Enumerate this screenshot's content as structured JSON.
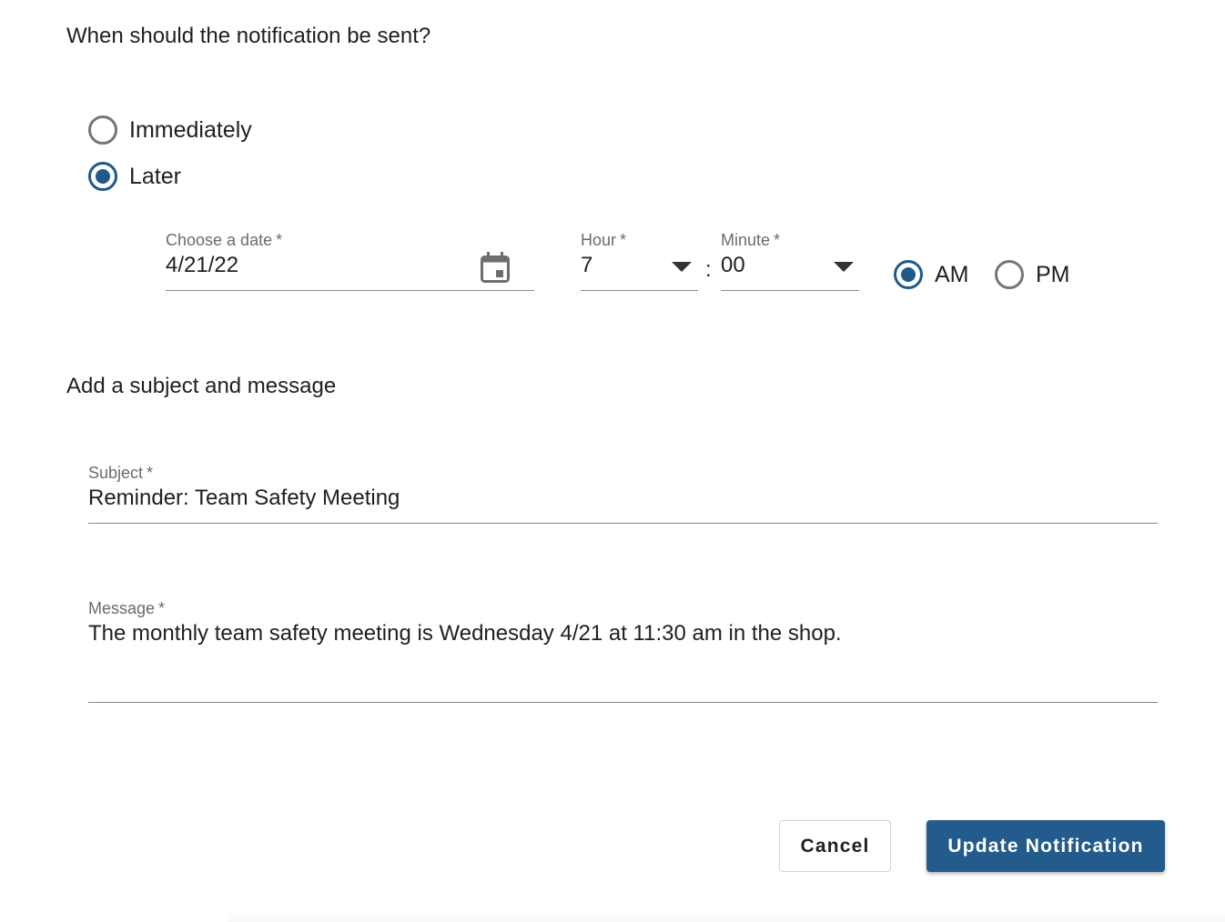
{
  "schedule": {
    "heading": "When should the notification be sent?",
    "options": [
      {
        "label": "Immediately",
        "checked": false
      },
      {
        "label": "Later",
        "checked": true
      }
    ],
    "date": {
      "label": "Choose a date",
      "required_mark": "*",
      "value": "4/21/22",
      "icon": "calendar-icon"
    },
    "hour": {
      "label": "Hour",
      "required_mark": "*",
      "value": "7",
      "icon": "caret-down-icon"
    },
    "separator": ":",
    "minute": {
      "label": "Minute",
      "required_mark": "*",
      "value": "00",
      "icon": "caret-down-icon"
    },
    "meridiem": [
      {
        "label": "AM",
        "checked": true
      },
      {
        "label": "PM",
        "checked": false
      }
    ]
  },
  "content": {
    "heading": "Add a subject and message",
    "subject": {
      "label": "Subject",
      "required_mark": "*",
      "value": "Reminder: Team Safety Meeting"
    },
    "message": {
      "label": "Message",
      "required_mark": "*",
      "value": "The monthly team safety meeting is Wednesday 4/21 at 11:30 am in the shop."
    }
  },
  "actions": {
    "cancel_label": "Cancel",
    "submit_label": "Update Notification"
  },
  "colors": {
    "accent": "#235b8c",
    "radio_unchecked": "#767676",
    "label_gray": "#6b6b6b"
  }
}
